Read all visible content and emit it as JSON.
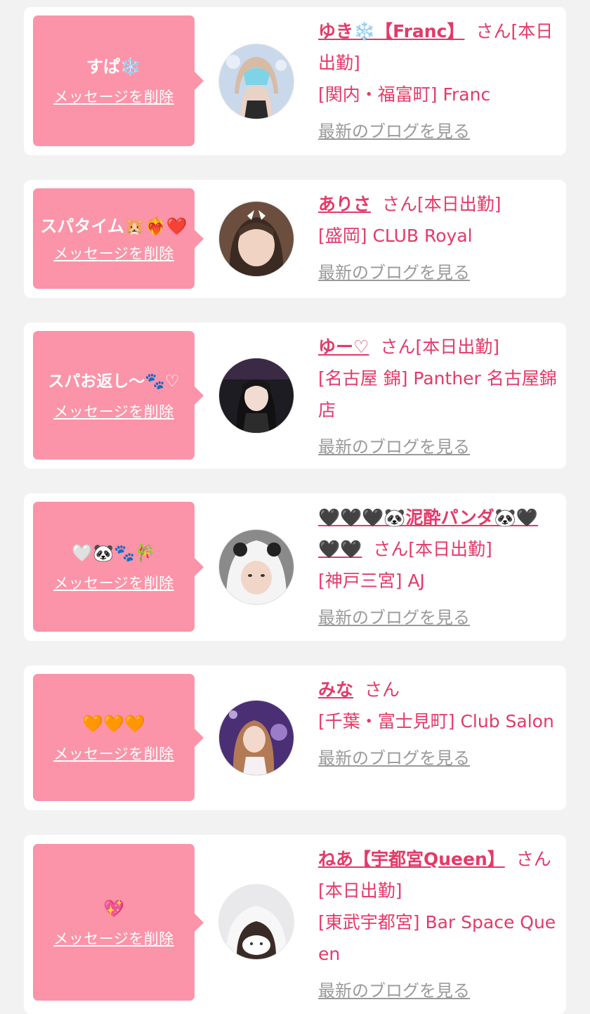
{
  "delete_label": "メッセージを削除",
  "blog_label": "最新のブログを見る",
  "san_label": "さん",
  "colors": {
    "accent": "#e33a67",
    "bubble": "#fb94a8",
    "background": "#f2f2f2",
    "card": "#ffffff",
    "blog_link": "#9a9a9a"
  },
  "messages": [
    {
      "message": "すぱ❄️",
      "name": "ゆき❄️【Franc】",
      "status": "[本日出勤]",
      "shop": "[関内・福富町] Franc",
      "avatar_icon": "girl-photo"
    },
    {
      "message": "スパタイム🐹❤️‍🔥❤️",
      "name": "ありさ",
      "status": "[本日出勤]",
      "shop": "[盛岡] CLUB Royal",
      "avatar_icon": "girl-photo"
    },
    {
      "message": "スパお返し〜🐾♡",
      "name": "ゆー♡",
      "status": "[本日出勤]",
      "shop": "[名古屋 錦] Panther 名古屋錦店",
      "avatar_icon": "girl-photo"
    },
    {
      "message": "🤍🐼🐾🎋",
      "name": "🖤🖤🖤🐼泥酔パンダ🐼🖤🖤🖤",
      "status": "[本日出勤]",
      "shop": "[神戸三宮] AJ",
      "avatar_icon": "girl-photo"
    },
    {
      "message": "🧡🧡🧡",
      "name": "みな",
      "status": "",
      "shop": "[千葉・富士見町] Club Salon",
      "avatar_icon": "girl-photo"
    },
    {
      "message": "💖",
      "name": "ねあ【宇都宮Queen】",
      "status": "[本日出勤]",
      "shop": "[東武宇都宮] Bar Space Queen",
      "avatar_icon": "girl-photo"
    }
  ]
}
